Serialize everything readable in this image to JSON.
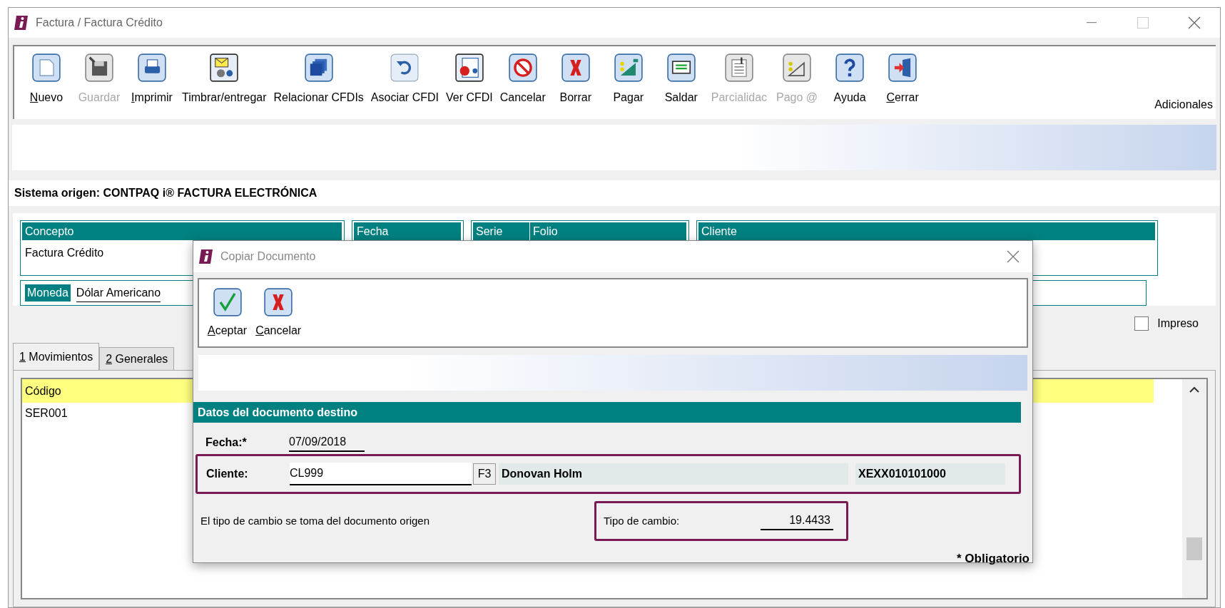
{
  "window": {
    "title": "Factura / Factura Crédito"
  },
  "toolbar": [
    {
      "label": "Nuevo",
      "disabled": false,
      "underline_first": true
    },
    {
      "label": "Guardar",
      "disabled": true,
      "underline_first": false
    },
    {
      "label": "Imprimir",
      "disabled": false,
      "underline_first": true
    },
    {
      "label": "Timbrar/entregar",
      "disabled": false,
      "underline_first": false
    },
    {
      "label": "Relacionar CFDIs",
      "disabled": false,
      "underline_first": false
    },
    {
      "label": "Asociar CFDI",
      "disabled": false,
      "underline_first": false
    },
    {
      "label": "Ver CFDI",
      "disabled": false,
      "underline_first": false
    },
    {
      "label": "Cancelar",
      "disabled": false,
      "underline_first": false
    },
    {
      "label": "Borrar",
      "disabled": false,
      "underline_first": false
    },
    {
      "label": "Pagar",
      "disabled": false,
      "underline_first": false
    },
    {
      "label": "Saldar",
      "disabled": false,
      "underline_first": false
    },
    {
      "label": "Parcialidac",
      "disabled": true,
      "underline_first": false
    },
    {
      "label": "Pago @",
      "disabled": true,
      "underline_first": false
    },
    {
      "label": "Ayuda",
      "disabled": false,
      "underline_first": false
    },
    {
      "label": "Cerrar",
      "disabled": false,
      "underline_first": true
    }
  ],
  "toolbar_extra": "Adicionales",
  "origin": "Sistema origen: CONTPAQ i® FACTURA ELECTRÓNICA",
  "header": {
    "concepto_label": "Concepto",
    "concepto_value": "Factura Crédito",
    "fecha_label": "Fecha",
    "serie_label": "Serie",
    "folio_label": "Folio",
    "cliente_label": "Cliente",
    "moneda_label": "Moneda",
    "moneda_value": "Dólar Americano"
  },
  "impreso": {
    "label": "Impreso",
    "checked": false
  },
  "tabs": [
    {
      "label": "1 Movimientos",
      "selected": true
    },
    {
      "label": "2 Generales",
      "selected": false
    }
  ],
  "grid": {
    "columns": [
      "Código"
    ],
    "rows": [
      [
        "SER001"
      ]
    ]
  },
  "dialog": {
    "title": "Copiar Documento",
    "buttons": [
      {
        "label": "Aceptar",
        "kind": "accept"
      },
      {
        "label": "Cancelar",
        "kind": "cancel"
      }
    ],
    "section": "Datos del documento destino",
    "fecha_label": "Fecha:*",
    "fecha_value": "07/09/2018",
    "cliente_label": "Cliente:",
    "cliente_value": "CL999",
    "lookup_key": "F3",
    "cliente_name": "Donovan Holm",
    "cliente_rfc": "XEXX010101000",
    "note": "El tipo de cambio se toma del documento origen",
    "tipo_label": "Tipo de cambio:",
    "tipo_value": "19.4433",
    "required_note": "* Obligatorio"
  }
}
